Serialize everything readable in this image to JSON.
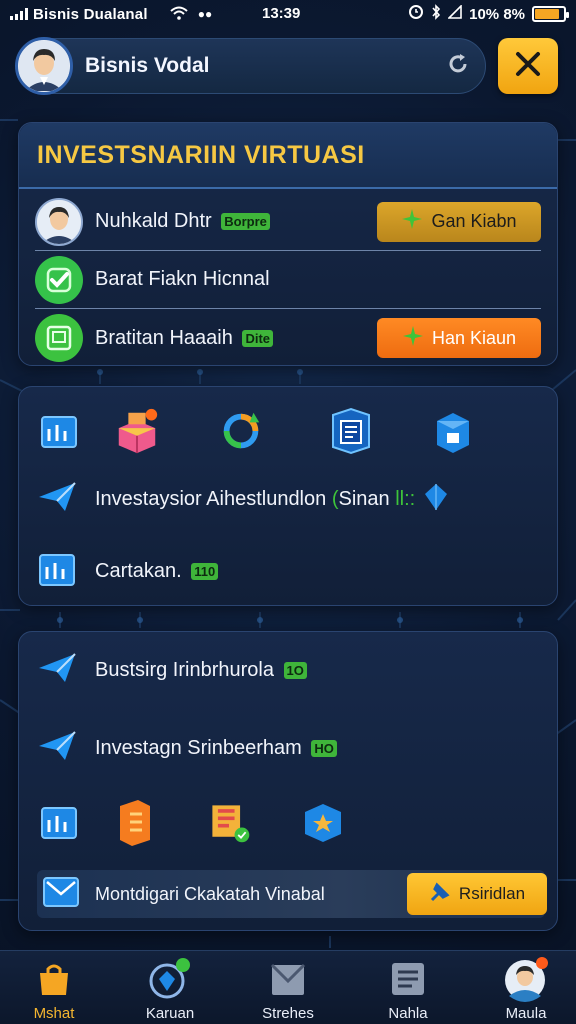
{
  "status_bar": {
    "carrier": "Bisnis Dualanal",
    "time": "13:39",
    "battery_text": "10% 8%",
    "battery_level": 0.85
  },
  "header": {
    "title": "Bisnis Vodal"
  },
  "panel_main": {
    "title": "INVESTSNARIIN VIRTUASI",
    "rows": [
      {
        "label": "Nuhkald Dhtr",
        "tag": "Borpre",
        "button": "Gan Kiabn"
      },
      {
        "label": "Barat Fiakn Hicnnal"
      },
      {
        "label": "Bratitan Haaaih",
        "tag": "Dite",
        "button": "Han Kiaun"
      }
    ]
  },
  "panel_features": {
    "items": [
      {
        "label": "Investaysior Aihestlundlon",
        "suffix": "Sinan",
        "suffix2": "ll::"
      },
      {
        "label": "Cartakan.",
        "tag": "110"
      }
    ]
  },
  "panel_bottom": {
    "items": [
      {
        "label": "Bustsirg Irinbrhurola",
        "tag": "1O"
      },
      {
        "label": "Investagn Srinbeerham",
        "tag": "HO"
      }
    ],
    "final_label": "Montdigari Ckakatah Vinabal",
    "final_button": "Rsiridlan"
  },
  "bottom_nav": {
    "items": [
      {
        "label": "Mshat"
      },
      {
        "label": "Karuan"
      },
      {
        "label": "Strehes"
      },
      {
        "label": "Nahla"
      },
      {
        "label": "Maula"
      }
    ]
  },
  "colors": {
    "accent_gold": "#f6c843",
    "accent_orange": "#ee6c10",
    "accent_green": "#3fb53a",
    "background": "#0c1830"
  }
}
